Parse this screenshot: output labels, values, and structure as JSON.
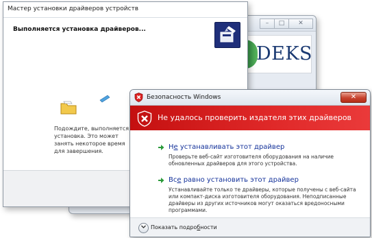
{
  "back_window": {
    "logo_text": "DEKS"
  },
  "wizard": {
    "title": "Мастер установки драйверов устройств",
    "heading": "Выполняется установка драйверов...",
    "wait_text": "Подождите, выполняется установка. Это может занять некоторое время для завершения."
  },
  "security": {
    "title": "Безопасность Windows",
    "banner": "Не удалось проверить издателя этих драйверов",
    "options": [
      {
        "title_prefix": "Н",
        "title_underlined": "е",
        "title_rest": " устанавливать этот драйвер",
        "desc": "Проверьте веб-сайт изготовителя оборудования на наличие обновленных драйверов для этого устройства."
      },
      {
        "title_prefix": "Вс",
        "title_underlined": "е",
        "title_rest": " равно установить этот драйвер",
        "desc": "Устанавливайте только те драйверы, которые получены с веб-сайта или компакт-диска изготовителя оборудования. Неподписанные драйверы из других источников могут оказаться вредоносными программами."
      }
    ],
    "details_prefix": "Показать подро",
    "details_underlined": "б",
    "details_rest": "ности",
    "close_symbol": "✕"
  },
  "colors": {
    "banner_red": "#d41c1c",
    "link_blue": "#14329a",
    "arrow_green": "#2a9a3a"
  }
}
